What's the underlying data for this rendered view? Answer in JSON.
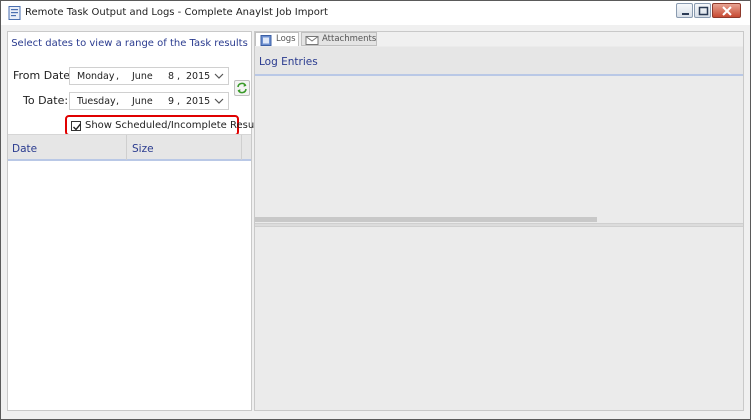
{
  "window": {
    "title": "Remote Task Output and Logs - Complete Anaylst Job Import",
    "icons": {
      "app": "document-icon",
      "minimize": "minimize-icon",
      "maximize": "maximize-icon",
      "close": "close-icon"
    }
  },
  "left": {
    "header": "Select dates to view a range of the Task results",
    "from": {
      "label": "From Date:",
      "weekday": "Monday",
      "sep": ",",
      "month": "June",
      "day": "8",
      "sep2": ",",
      "year": "2015"
    },
    "to": {
      "label": "To Date:",
      "weekday": "Tuesday",
      "sep": ",",
      "month": "June",
      "day": "9",
      "sep2": ",",
      "year": "2015"
    },
    "refresh_icon": "refresh-icon",
    "show_scheduled": {
      "label": "Show Scheduled/Incomplete Results",
      "checked": true
    },
    "columns": [
      "Date",
      "Size"
    ],
    "rows": []
  },
  "right": {
    "tabs": [
      {
        "label": "Logs",
        "icon": "notebook-icon",
        "active": true
      },
      {
        "label": "Attachments",
        "icon": "envelope-icon",
        "active": false
      }
    ],
    "log_header": "Log Entries"
  },
  "colors": {
    "accent_text": "#2a3b8f",
    "highlight_box": "#e00000"
  }
}
